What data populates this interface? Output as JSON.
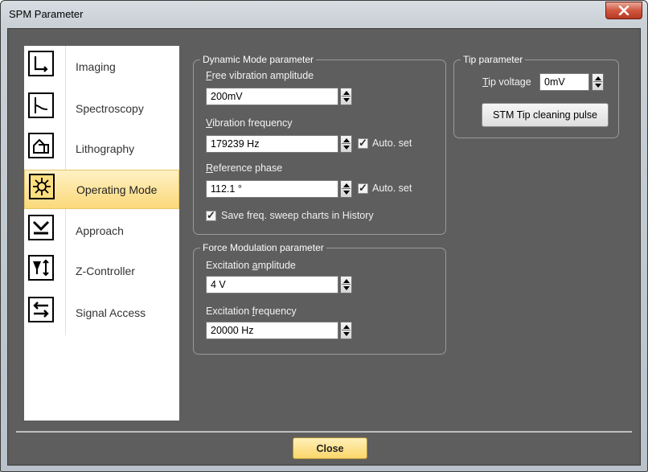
{
  "window": {
    "title": "SPM Parameter",
    "close_icon": "close-x-icon"
  },
  "sidebar": {
    "items": [
      {
        "label": "Imaging",
        "icon": "imaging-icon"
      },
      {
        "label": "Spectroscopy",
        "icon": "spectroscopy-icon"
      },
      {
        "label": "Lithography",
        "icon": "lithography-icon"
      },
      {
        "label": "Operating Mode",
        "icon": "operating-mode-icon",
        "selected": true
      },
      {
        "label": "Approach",
        "icon": "approach-icon"
      },
      {
        "label": "Z-Controller",
        "icon": "z-controller-icon"
      },
      {
        "label": "Signal Access",
        "icon": "signal-access-icon"
      }
    ]
  },
  "dynamic": {
    "legend": "Dynamic Mode parameter",
    "free_amp": {
      "label_u": "F",
      "label_rest": "ree vibration amplitude",
      "value": "200mV"
    },
    "vib_freq": {
      "label_u": "V",
      "label_rest": "ibration frequency",
      "value": "179239 Hz",
      "auto_label": "Auto. set",
      "auto_checked": true
    },
    "ref_phase": {
      "label_u": "R",
      "label_rest": "eference phase",
      "value": "112.1 °",
      "auto_label": "Auto. set",
      "auto_checked": true
    },
    "save_sweep": {
      "label": "Save freq. sweep charts in History",
      "checked": true
    }
  },
  "force": {
    "legend": "Force Modulation parameter",
    "exc_amp": {
      "label_pre": "Excitation ",
      "label_u": "a",
      "label_rest": "mplitude",
      "value": "4 V"
    },
    "exc_freq": {
      "label_pre": "Excitation ",
      "label_u": "f",
      "label_rest": "requency",
      "value": "20000 Hz"
    }
  },
  "tip": {
    "legend": "Tip parameter",
    "voltage": {
      "label_u": "T",
      "label_rest": "ip voltage",
      "value": "0mV"
    },
    "clean_button": "STM Tip cleaning pulse"
  },
  "footer": {
    "close_button": "Close"
  },
  "colors": {
    "panel_bg": "#5e5e5e",
    "selected_bg": "#fddf80",
    "close_button_bg": "#fde48e"
  }
}
